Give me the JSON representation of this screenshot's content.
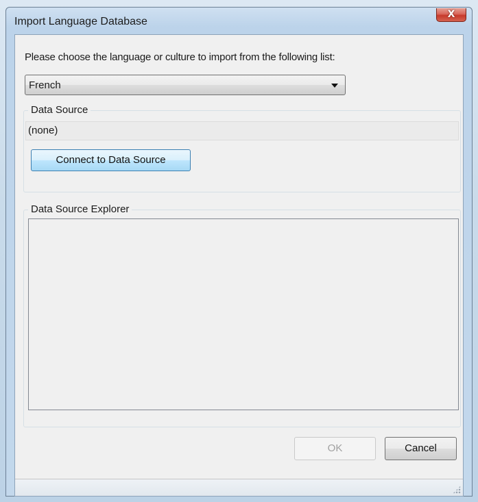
{
  "window": {
    "title": "Import Language Database",
    "close_symbol": "X"
  },
  "form": {
    "prompt": "Please choose the language or culture to import from the following list:",
    "language_select": {
      "selected_value": "French"
    },
    "data_source_group": {
      "legend": "Data Source",
      "source_value": "(none)",
      "connect_button_label": "Connect to Data Source"
    },
    "explorer_group": {
      "legend": "Data Source Explorer"
    }
  },
  "buttons": {
    "ok_label": "OK",
    "cancel_label": "Cancel"
  },
  "icons": {
    "close": "close-icon",
    "dropdown": "chevron-down-icon",
    "grip": "size-grip-icon"
  },
  "colors": {
    "close_button": "#c63a2c",
    "connect_button": "#bee6fd",
    "dialog_background": "#f0f0f0",
    "disabled_text": "#a0a0a0"
  }
}
